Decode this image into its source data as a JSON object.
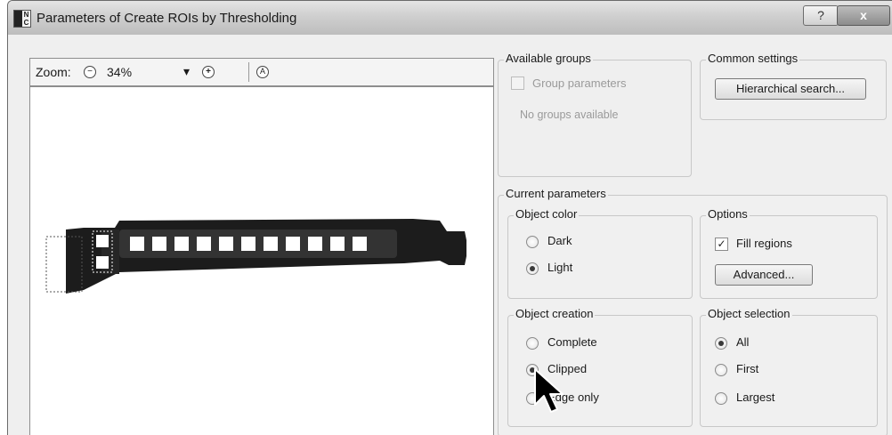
{
  "window": {
    "title": "Parameters of Create ROIs by Thresholding",
    "icon_letters": [
      "",
      "N",
      "",
      "C"
    ],
    "help_label": "?",
    "close_label": "x"
  },
  "zoom": {
    "label": "Zoom:",
    "value": "34%",
    "minus_glyph": "−",
    "plus_glyph": "+",
    "dropdown_glyph": "▾",
    "fit_glyph": "A"
  },
  "groups": {
    "available_groups": {
      "title": "Available groups",
      "group_parameters_label": "Group parameters",
      "group_parameters_checked": false,
      "empty_text": "No groups available"
    },
    "common_settings": {
      "title": "Common settings",
      "hierarchical_button": "Hierarchical search..."
    },
    "current_parameters": {
      "title": "Current parameters",
      "object_color": {
        "title": "Object color",
        "options": [
          "Dark",
          "Light"
        ],
        "selected": "Light"
      },
      "options": {
        "title": "Options",
        "fill_regions_label": "Fill regions",
        "fill_regions_checked": true,
        "check_glyph": "✓",
        "advanced_button": "Advanced..."
      },
      "object_creation": {
        "title": "Object creation",
        "options": [
          "Complete",
          "Clipped",
          "Edge only"
        ],
        "selected": "Clipped"
      },
      "object_selection": {
        "title": "Object selection",
        "options": [
          "All",
          "First",
          "Largest"
        ],
        "selected": "All"
      }
    }
  },
  "preview": {
    "slot_count": 12
  },
  "colors": {
    "titlebar": "#cfcfcf",
    "client": "#efefef",
    "part": "#1c1c1c",
    "slot": "#ffffff"
  }
}
